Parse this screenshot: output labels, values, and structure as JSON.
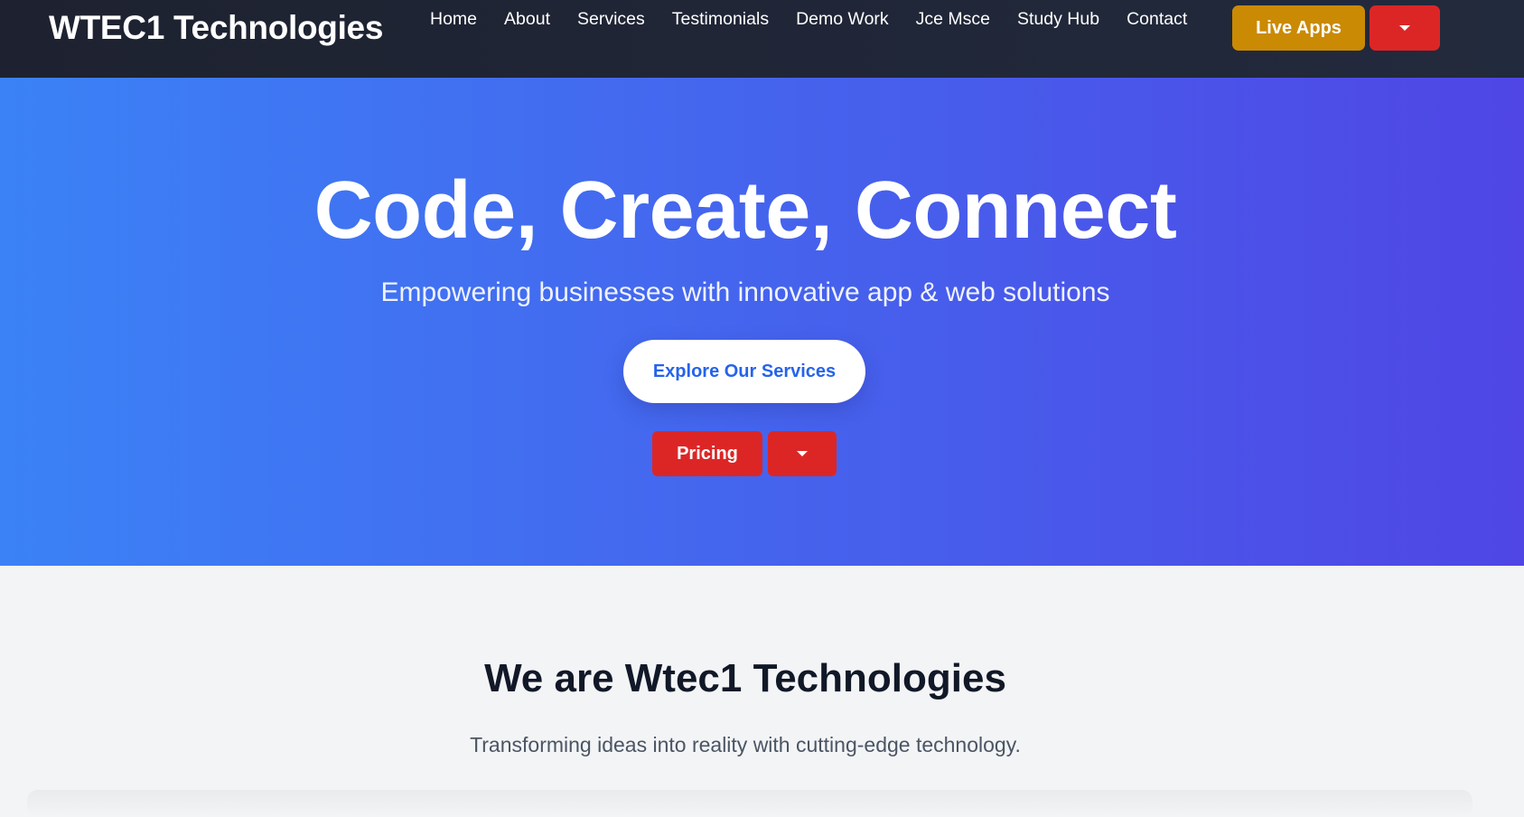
{
  "navbar": {
    "brand": "WTEC1 Technologies",
    "links": [
      "Home",
      "About",
      "Services",
      "Testimonials",
      "Demo Work",
      "Jce Msce",
      "Study Hub",
      "Contact"
    ],
    "live_apps_label": "Live Apps"
  },
  "hero": {
    "title": "Code, Create, Connect",
    "subtitle": "Empowering businesses with innovative app & web solutions",
    "explore_label": "Explore Our Services",
    "pricing_label": "Pricing"
  },
  "about": {
    "title": "We are Wtec1 Technologies",
    "subtitle": "Transforming ideas into reality with cutting-edge technology."
  },
  "colors": {
    "nav_bg": "#1e2230",
    "hero_start": "#3b82f6",
    "hero_end": "#4f46e5",
    "live_apps": "#ca8a04",
    "red": "#dc2626",
    "explore_text": "#2563eb"
  }
}
